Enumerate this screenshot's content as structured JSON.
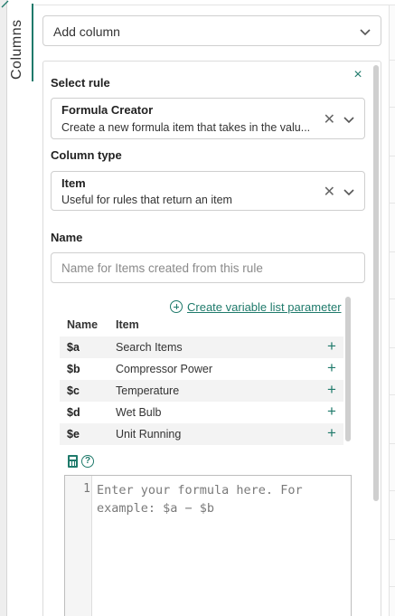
{
  "side_tab": {
    "label": "Columns"
  },
  "add_column": {
    "label": "Add column"
  },
  "rule_panel": {
    "close_label": "×",
    "select_rule": {
      "label": "Select rule",
      "title": "Formula Creator",
      "description": "Create a new formula item that takes in the valu..."
    },
    "column_type": {
      "label": "Column type",
      "title": "Item",
      "description": "Useful for rules that return an item"
    },
    "name": {
      "label": "Name",
      "placeholder": "Name for Items created from this rule",
      "value": ""
    },
    "create_variable_label": "Create variable list parameter",
    "variables": {
      "headers": {
        "name": "Name",
        "item": "Item"
      },
      "rows": [
        {
          "name": "$a",
          "item": "Search Items"
        },
        {
          "name": "$b",
          "item": "Compressor Power"
        },
        {
          "name": "$c",
          "item": "Temperature"
        },
        {
          "name": "$d",
          "item": "Wet Bulb"
        },
        {
          "name": "$e",
          "item": "Unit Running"
        }
      ],
      "add_glyph": "+"
    },
    "formula": {
      "help_glyph": "?",
      "line_number": "1",
      "placeholder": "Enter your formula here. For example: $a − $b"
    }
  },
  "colors": {
    "accent": "#1f7a6b"
  }
}
